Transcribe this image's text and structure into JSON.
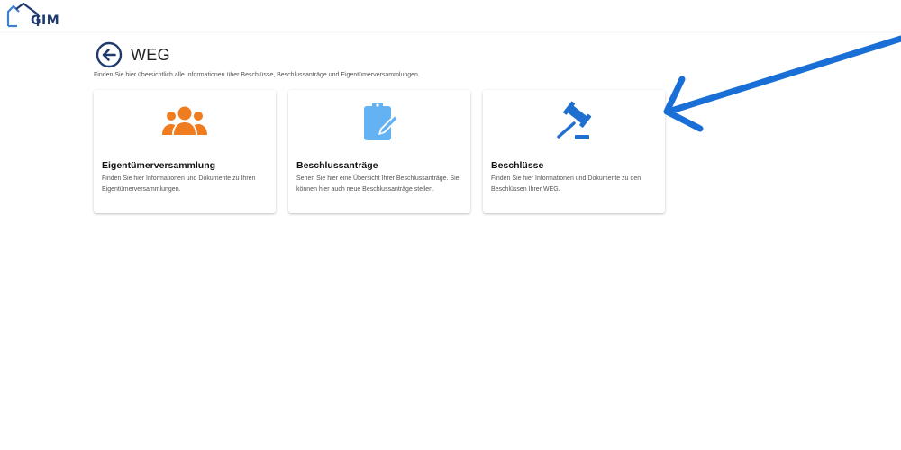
{
  "header": {
    "logo_text": "GIM"
  },
  "page": {
    "title": "WEG",
    "subtitle": "Finden Sie hier übersichtlich alle Informationen über Beschlüsse, Beschlussanträge und Eigentümerversammlungen."
  },
  "cards": [
    {
      "icon": "people-group-icon",
      "title": "Eigentümerversammlung",
      "description": "Finden Sie hier Informationen und Dokumente zu Ihren Eigentümerversammlungen."
    },
    {
      "icon": "clipboard-edit-icon",
      "title": "Beschlussanträge",
      "description": "Sehen Sie hier eine Übersicht Ihrer Beschlussanträge. Sie können hier auch neue Beschlussanträge stellen."
    },
    {
      "icon": "gavel-icon",
      "title": "Beschlüsse",
      "description": "Finden Sie hier Informationen und Dokumente zu den Beschlüssen Ihrer WEG."
    }
  ],
  "colors": {
    "brand_blue": "#1e3a6e",
    "logo_blue": "#3d7fd1",
    "orange": "#ef7d1f",
    "light_blue": "#64b2f2",
    "gavel_blue": "#1f6fd1",
    "annotation_blue": "#1a6fd6"
  }
}
